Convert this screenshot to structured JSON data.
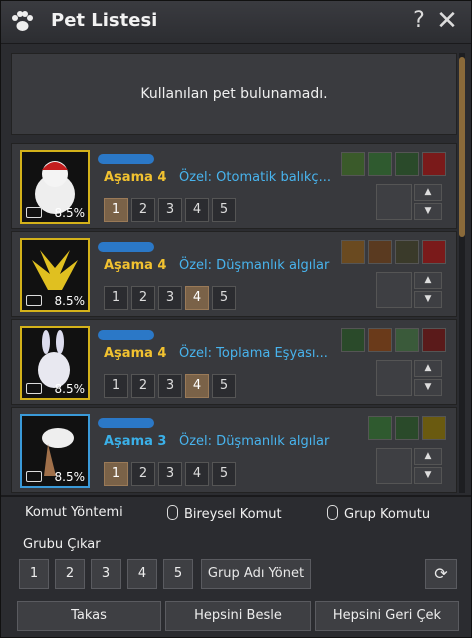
{
  "window": {
    "title": "Pet Listesi",
    "help": "?",
    "close": "✕"
  },
  "notice": "Kullanılan pet bulunamadı.",
  "pets": [
    {
      "stage": "Aşama 4",
      "special": "Özel: Otomatik balıkç...",
      "pct": "8.5%",
      "active": 1
    },
    {
      "stage": "Aşama 4",
      "special": "Özel: Düşmanlık algılar",
      "pct": "8.5%",
      "active": 4
    },
    {
      "stage": "Aşama 4",
      "special": "Özel: Toplama Eşyası...",
      "pct": "8.5%",
      "active": 4
    },
    {
      "stage": "Aşama 3",
      "special": "Özel: Düşmanlık algılar",
      "pct": "8.5%",
      "active": 1
    }
  ],
  "slots": [
    "1",
    "2",
    "3",
    "4",
    "5"
  ],
  "methods": {
    "label": "Komut Yöntemi",
    "individual": "Bireysel Komut",
    "group": "Grup Komutu"
  },
  "group": {
    "title": "Grubu Çıkar",
    "buttons": [
      "1",
      "2",
      "3",
      "4",
      "5"
    ],
    "name_button": "Grup Adı Yönet"
  },
  "bottom": {
    "trade": "Takas",
    "feed": "Hepsini Besle",
    "recall": "Hepsini Geri Çek"
  }
}
